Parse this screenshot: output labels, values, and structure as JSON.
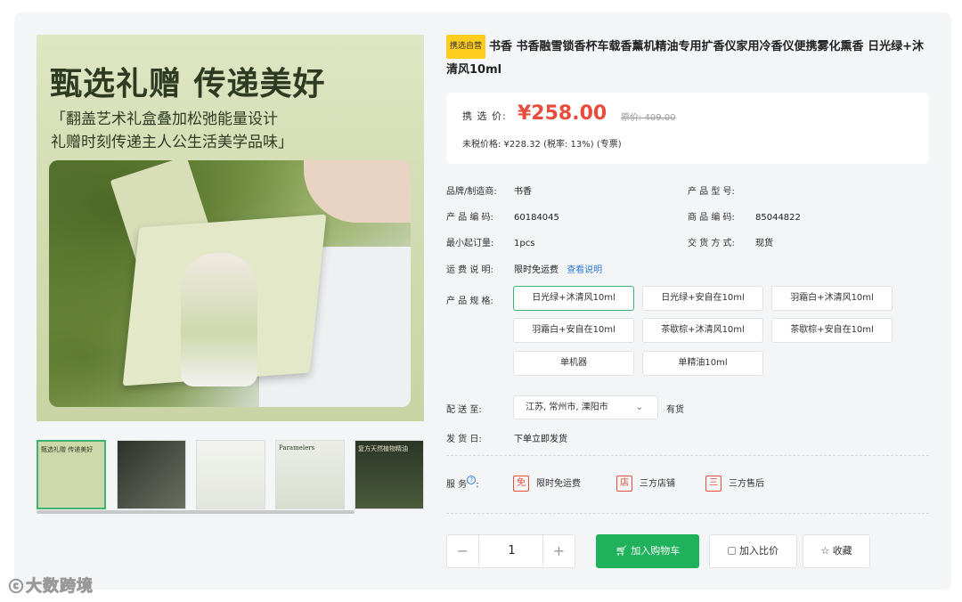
{
  "gallery": {
    "main_title": "甄选礼赠 传递美好",
    "main_sub1": "「翻盖艺术礼盒叠加松弛能量设计",
    "main_sub2": "礼赠时刻传递主人公生活美学品味」",
    "thumbnails": [
      {
        "text": "甄选礼赠 传递美好",
        "bg": "#cdd8ab"
      },
      {
        "text": "",
        "bg": "#3a3f35"
      },
      {
        "text": "",
        "bg": "#eef0ea"
      },
      {
        "text": "Paramelers",
        "bg": "#e4e7df"
      },
      {
        "text": "复方天然植物精油",
        "bg": "#2f3a2a"
      }
    ]
  },
  "product": {
    "badge": "携选自营",
    "title": "书香 书香融雪锁香杯车载香薰机精油专用扩香仪家用冷香仪便携雾化熏香 日光绿+沐清风10ml"
  },
  "price": {
    "label": "携 选 价:",
    "current": "¥258.00",
    "original": "原价: 409.00",
    "tax_line": "未税价格: ¥228.32 (税率: 13%) (专票)"
  },
  "attributes": {
    "brand_label": "品牌/制造商:",
    "brand_value": "书香",
    "model_label": "产 品 型 号:",
    "model_value": "",
    "code_label": "产 品 编 码:",
    "code_value": "60184045",
    "goods_code_label": "商 品 编 码:",
    "goods_code_value": "85044822",
    "moq_label": "最小起订量:",
    "moq_value": "1pcs",
    "delivery_label": "交 货 方 式:",
    "delivery_value": "现货",
    "shipping_label": "运 费 说 明:",
    "shipping_value": "限时免运费",
    "shipping_link": "查看说明",
    "spec_label": "产 品 规 格:"
  },
  "specs": [
    "日光绿+沐清风10ml",
    "日光绿+安自在10ml",
    "羽霜白+沐清风10ml",
    "羽霜白+安自在10ml",
    "茶歇棕+沐清风10ml",
    "茶歇棕+安自在10ml",
    "单机器",
    "单精油10ml"
  ],
  "selected_spec": "日光绿+沐清风10ml",
  "ship_to": {
    "label": "配 送 至:",
    "value": "江苏, 常州市, 溧阳市",
    "stock": "有货"
  },
  "dispatch": {
    "label": "发 货 日:",
    "value": "下单立即发货"
  },
  "service": {
    "label": "服 务",
    "items": [
      {
        "tag": "免",
        "text": "限时免运费"
      },
      {
        "tag": "店",
        "text": "三方店铺"
      },
      {
        "tag": "三",
        "text": "三方售后"
      }
    ]
  },
  "actions": {
    "qty": "1",
    "minus": "−",
    "plus": "+",
    "cart": "加入购物车",
    "compare": "加入比价",
    "favorite": "收藏"
  },
  "watermark": "大数跨境",
  "colors": {
    "accent_green": "#1fb15b",
    "price_red": "#e74c3c",
    "badge_yellow": "#ffcd1e",
    "link_blue": "#2d7bd8"
  }
}
